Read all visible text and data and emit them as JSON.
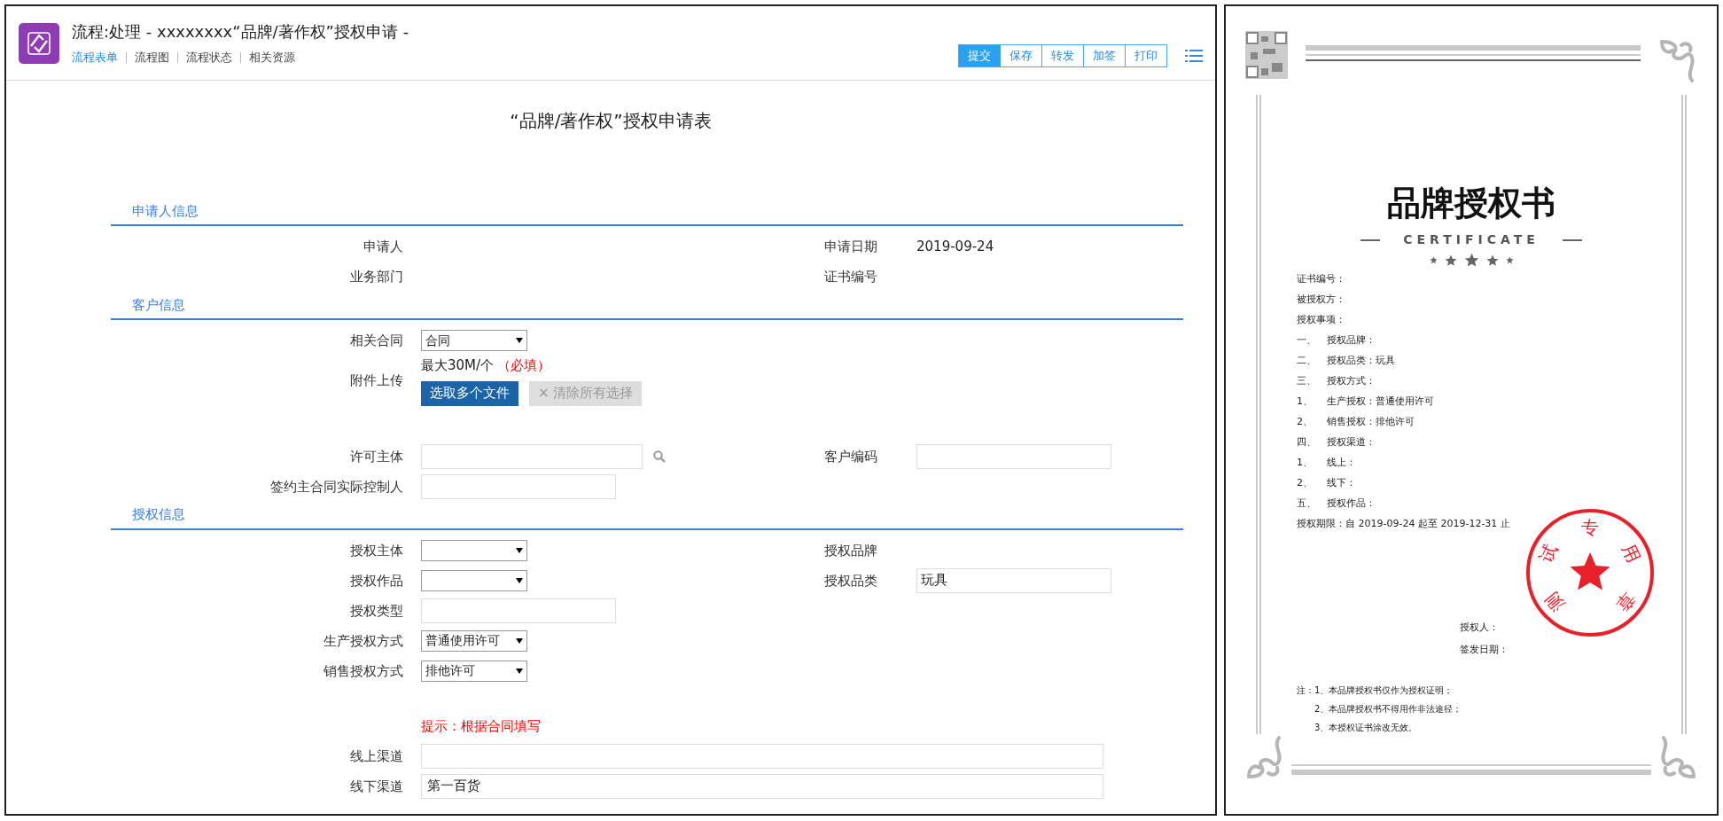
{
  "header": {
    "title": "流程:处理 - xxxxxxxx“品牌/著作权”授权申请 -",
    "tabs": [
      {
        "label": "流程表单",
        "selected": true
      },
      {
        "label": "流程图",
        "selected": false
      },
      {
        "label": "流程状态",
        "selected": false
      },
      {
        "label": "相关资源",
        "selected": false
      }
    ],
    "actions": [
      {
        "label": "提交",
        "primary": true
      },
      {
        "label": "保存",
        "primary": false
      },
      {
        "label": "转发",
        "primary": false
      },
      {
        "label": "加签",
        "primary": false
      },
      {
        "label": "打印",
        "primary": false
      }
    ]
  },
  "form": {
    "title": "“品牌/著作权”授权申请表",
    "sections": [
      {
        "title": "申请人信息",
        "rows": [
          {
            "left": {
              "kind": "text",
              "label": "申请人"
            },
            "right": {
              "kind": "text",
              "label": "申请日期",
              "value": "2019-09-24"
            }
          },
          {
            "left": {
              "kind": "text",
              "label": "业务部门"
            },
            "right": {
              "kind": "text",
              "label": "证书编号"
            }
          }
        ]
      },
      {
        "title": "客户信息",
        "rows": [
          {
            "left": {
              "kind": "select",
              "label": "相关合同",
              "value": "合同"
            }
          },
          {
            "left": {
              "kind": "upload",
              "label": "附件上传",
              "note": "最大30M/个",
              "required": "（必填）",
              "buttons": [
                {
                  "label": "选取多个文件",
                  "disabled": false
                },
                {
                  "label": "清除所有选择",
                  "icon": "×",
                  "disabled": true
                }
              ]
            }
          },
          {
            "left": {
              "kind": "search",
              "label": "许可主体"
            },
            "right": {
              "kind": "input",
              "label": "客户编码"
            }
          },
          {
            "left": {
              "kind": "input",
              "label": "签约主合同实际控制人"
            }
          }
        ]
      },
      {
        "title": "授权信息",
        "rows": [
          {
            "left": {
              "kind": "select",
              "label": "授权主体"
            },
            "right": {
              "kind": "text",
              "label": "授权品牌"
            }
          },
          {
            "left": {
              "kind": "select",
              "label": "授权作品"
            },
            "right": {
              "kind": "input",
              "label": "授权品类",
              "value": "玩具"
            }
          },
          {
            "left": {
              "kind": "input",
              "label": "授权类型"
            }
          },
          {
            "left": {
              "kind": "select",
              "label": "生产授权方式",
              "value": "普通使用许可"
            }
          },
          {
            "left": {
              "kind": "select",
              "label": "销售授权方式",
              "value": "排他许可"
            }
          },
          {
            "left": {
              "kind": "hint",
              "label": "提示：根据合同填写"
            }
          },
          {
            "left": {
              "kind": "wide",
              "label": "线上渠道"
            }
          },
          {
            "left": {
              "kind": "wide",
              "label": "线下渠道",
              "value": "第一百货"
            }
          }
        ]
      }
    ]
  },
  "certificate": {
    "title": "品牌授权书",
    "subtitle": "CERTIFICATE",
    "lines": [
      {
        "text": "证书编号："
      },
      {
        "text": "被授权方："
      },
      {
        "text": "授权事项："
      },
      {
        "marker": "一、",
        "text": "授权品牌："
      },
      {
        "marker": "二、",
        "text": "授权品类：玩具"
      },
      {
        "marker": "三、",
        "text": "授权方式："
      },
      {
        "marker": "1、",
        "text": "生产授权：普通使用许可"
      },
      {
        "marker": "2、",
        "text": "销售授权：排他许可"
      },
      {
        "marker": "四、",
        "text": "授权渠道："
      },
      {
        "marker": "1、",
        "text": "线上："
      },
      {
        "marker": "2、",
        "text": "线下："
      },
      {
        "marker": "五、",
        "text": "授权作品："
      },
      {
        "text": "授权期限：自 2019-09-24 起至 2019-12-31 止"
      }
    ],
    "signer_label": "授权人：",
    "date_label": "签发日期：",
    "notes": [
      "注：1、本品牌授权书仅作为授权证明；",
      "2、本品牌授权书不得用作非法途径；",
      "3、本授权证书涂改无效。"
    ],
    "seal": {
      "text": "测试专用章"
    }
  }
}
